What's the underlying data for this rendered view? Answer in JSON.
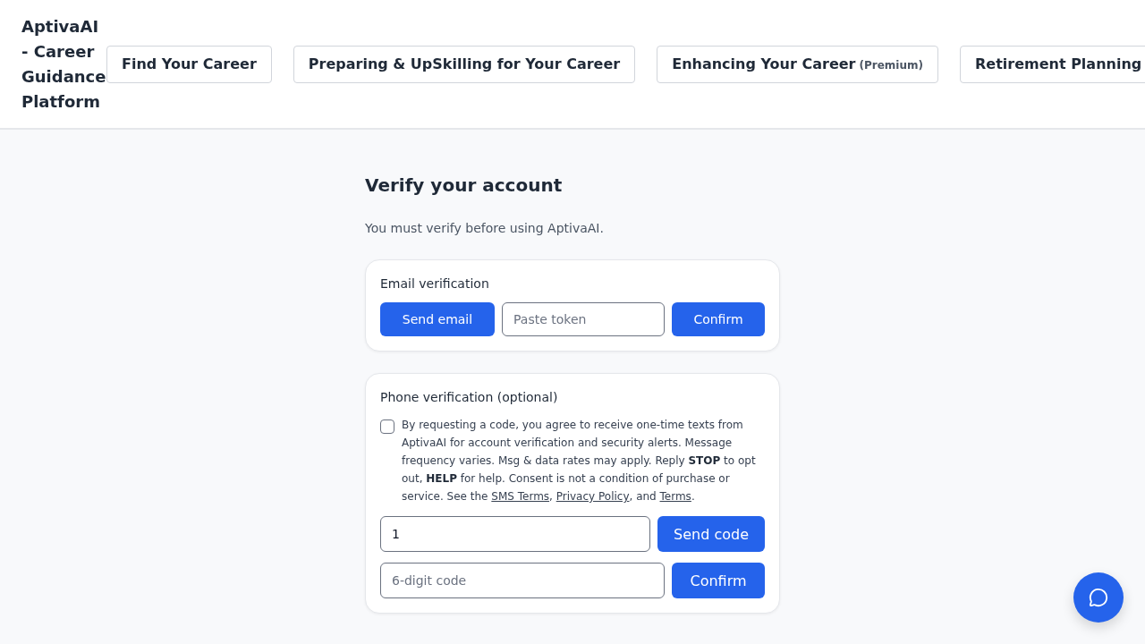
{
  "header": {
    "brand": "AptivaAI - Career Guidance Platform",
    "nav": [
      {
        "label": "Find Your Career"
      },
      {
        "label": "Preparing & UpSkilling for Your Career"
      },
      {
        "label": "Enhancing Your Career",
        "badge": "(Premium)"
      },
      {
        "label": "Retirement Planning"
      }
    ]
  },
  "verify": {
    "title": "Verify your account",
    "subtitle": "You must verify before using AptivaAI.",
    "email_card": {
      "title": "Email verification",
      "send_button": "Send email",
      "token_field": {
        "placeholder": "Paste token"
      },
      "confirm_button": "Confirm"
    },
    "phone_card": {
      "title": "Phone verification (optional)",
      "consent": {
        "checked": false,
        "parts": [
          {
            "kind": "text",
            "text": "By requesting a code, you agree to receive one-time texts from AptivaAI for account verification and security alerts. Message frequency varies. Msg & data rates may apply. Reply **STOP** to opt out, **HELP** for help. Consent is not a condition of purchase or service. See the "
          },
          {
            "kind": "link",
            "text": "SMS Terms"
          },
          {
            "kind": "text",
            "text": ", "
          },
          {
            "kind": "link",
            "text": "Privacy Policy"
          },
          {
            "kind": "text",
            "text": ", and "
          },
          {
            "kind": "link",
            "text": "Terms"
          },
          {
            "kind": "text",
            "text": "."
          }
        ]
      },
      "phone_field": {
        "value": "1"
      },
      "send_button": "Send code",
      "code_field": {
        "placeholder": "6-digit code"
      },
      "confirm_button": "Confirm"
    }
  }
}
